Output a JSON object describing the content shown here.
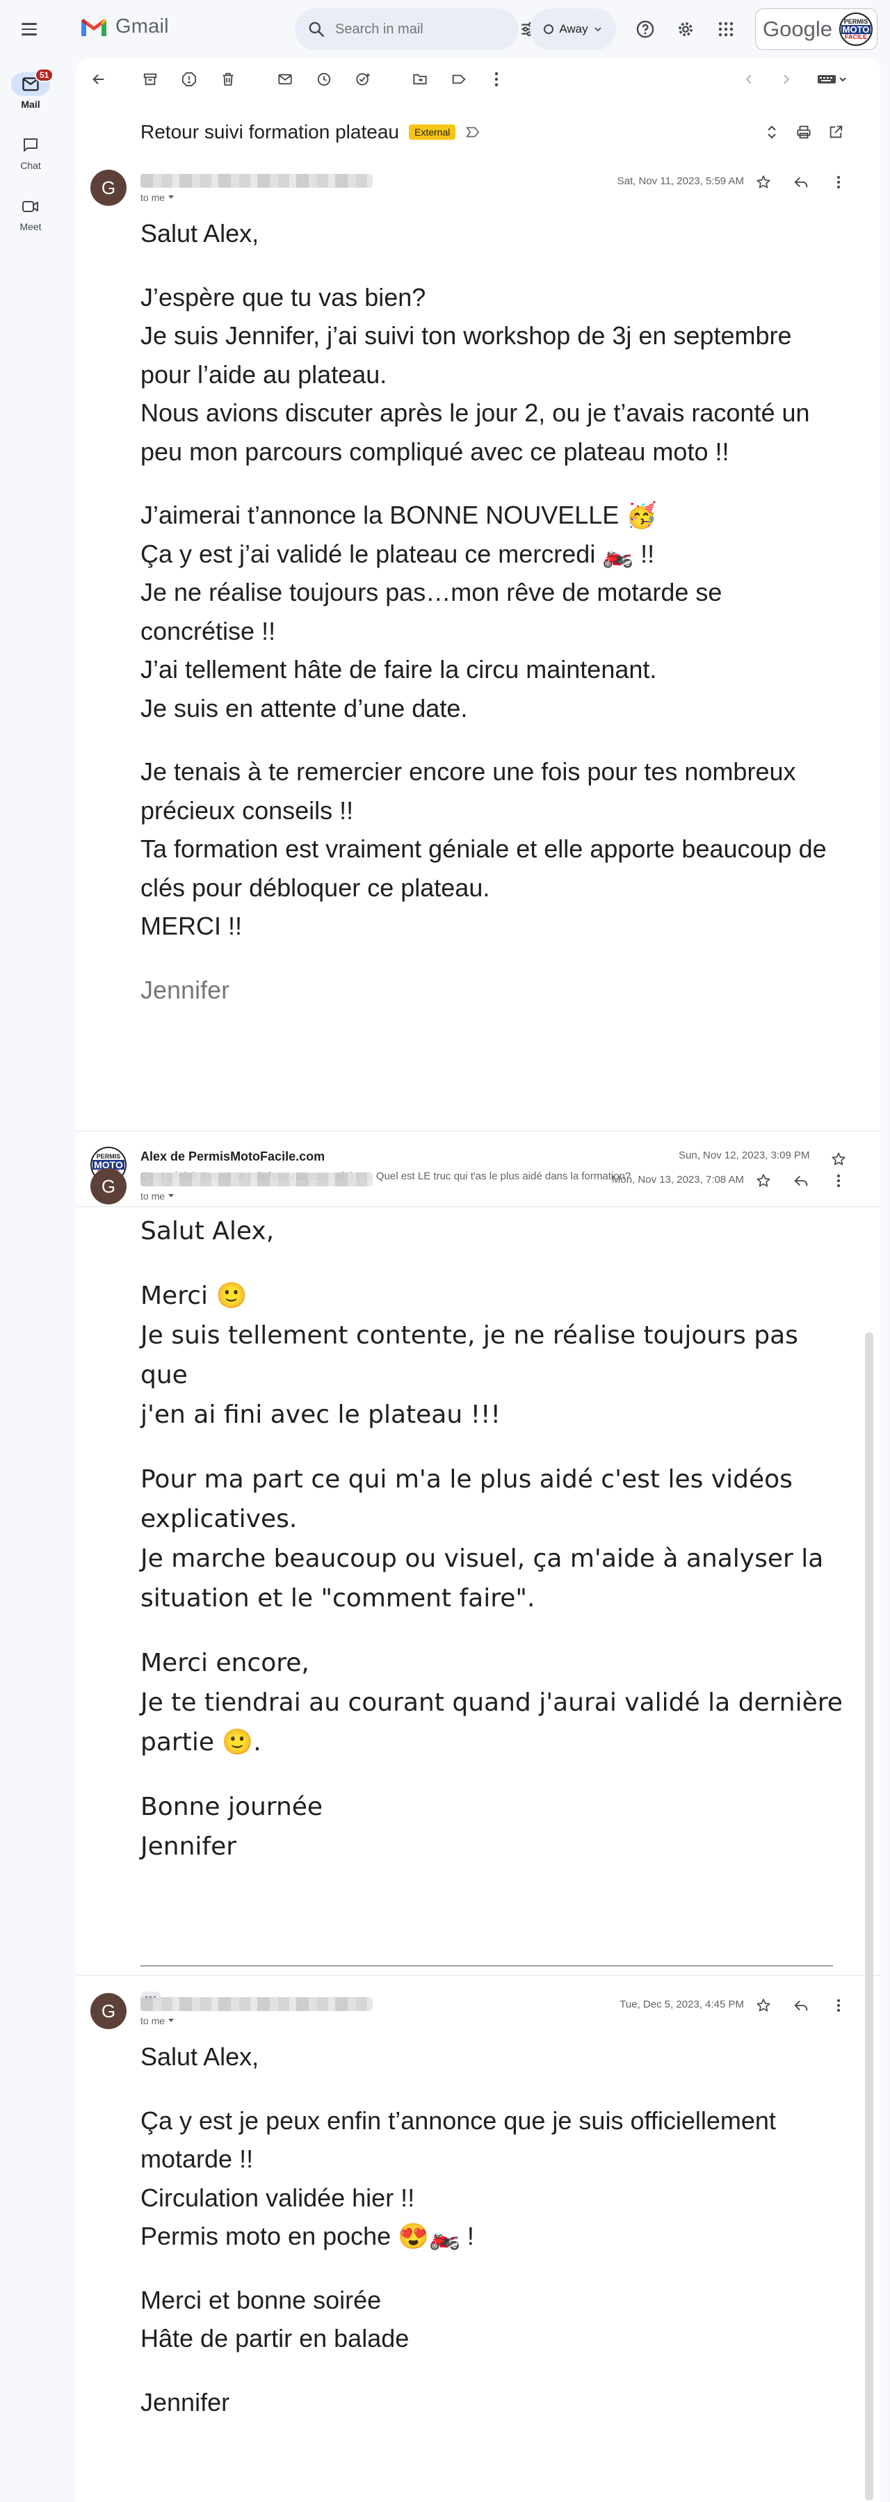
{
  "app": {
    "name": "Gmail",
    "google_word": "Google"
  },
  "search": {
    "placeholder": "Search in mail"
  },
  "status": {
    "label": "Away"
  },
  "account": {
    "line1": "PERMIS",
    "line2": "MOTO",
    "line3": "FACILE"
  },
  "nav": {
    "mail": {
      "label": "Mail",
      "badge": "51"
    },
    "chat": {
      "label": "Chat"
    },
    "meet": {
      "label": "Meet"
    }
  },
  "thread": {
    "subject": "Retour suivi formation plateau",
    "label": "External"
  },
  "messages": [
    {
      "avatar_letter": "G",
      "to": "to me",
      "date": "Sat, Nov 11, 2023, 5:59 AM",
      "lines": [
        "Salut Alex,",
        "",
        "J’espère que tu vas bien?",
        "Je suis Jennifer, j’ai suivi ton workshop de 3j en septembre",
        "pour l’aide au plateau.",
        "Nous avions discuter après le jour 2, ou je t’avais raconté un",
        "peu mon parcours compliqué avec ce plateau moto !!",
        "",
        "J’aimerai t’annonce la BONNE NOUVELLE 🥳",
        "Ça y est j’ai validé le plateau ce mercredi 🏍️ !!",
        "Je ne réalise toujours pas…mon rêve de motarde se",
        "concrétise !!",
        "J’ai tellement hâte de faire la circu maintenant.",
        "Je suis en attente d’une date.",
        "",
        "Je tenais à te remercier encore une fois pour tes nombreux",
        "précieux conseils !!",
        "Ta formation est vraiment géniale et elle apporte beaucoup de",
        "clés pour débloquer ce plateau.",
        "MERCI !!",
        "",
        "Jennifer"
      ]
    },
    {
      "sender": "Alex de PermisMotoFacile.com",
      "snippet": "C'est génial! Bravo! Je suis heureux pour toi :) PS: Quel est LE truc qui t'as le plus aidé dans la formation?",
      "date": "Sun, Nov 12, 2023, 3:09 PM"
    },
    {
      "avatar_letter": "G",
      "to": "to me",
      "date": "Mon, Nov 13, 2023, 7:08 AM",
      "lines": [
        "Salut Alex,",
        "",
        "Merci 🙂",
        "Je suis tellement contente, je ne réalise toujours pas que",
        "j'en ai fini avec le plateau !!!",
        "",
        "Pour ma part ce qui m'a le plus aidé c'est les vidéos",
        "explicatives.",
        "Je marche beaucoup ou visuel, ça m'aide à analyser la",
        "situation et le \"comment faire\".",
        "",
        "Merci encore,",
        "Je te tiendrai au courant quand j'aurai validé la dernière",
        "partie 🙂.",
        "",
        "Bonne journée",
        "Jennifer"
      ],
      "dots": "•••"
    },
    {
      "avatar_letter": "G",
      "to": "to me",
      "date": "Tue, Dec 5, 2023, 4:45 PM",
      "lines": [
        "Salut Alex,",
        "",
        "Ça y est je peux enfin t’annonce que je suis officiellement",
        "motarde !!",
        "Circulation validée hier !!",
        "Permis moto en poche 😍🏍️ !",
        "",
        "Merci et bonne soirée",
        "Hâte de partir en balade",
        "",
        "Jennifer"
      ]
    }
  ]
}
